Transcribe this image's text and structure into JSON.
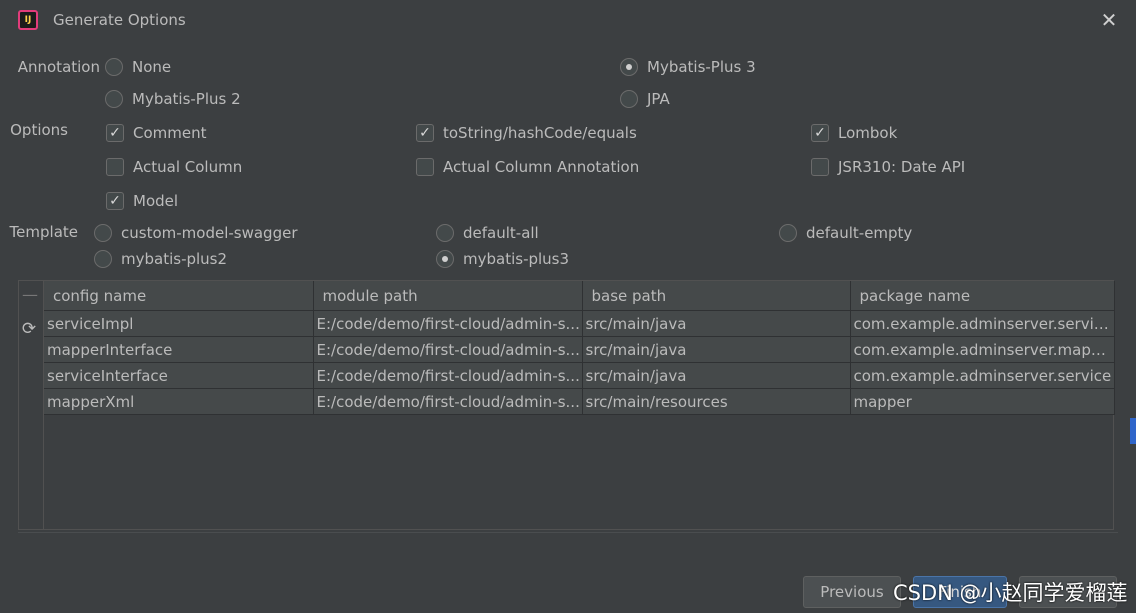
{
  "window": {
    "title": "Generate Options",
    "icon_name": "intellij-icon",
    "close_icon": "close-icon"
  },
  "annotation": {
    "label": "Annotation",
    "options": [
      {
        "label": "None",
        "checked": false
      },
      {
        "label": "Mybatis-Plus 3",
        "checked": true
      },
      {
        "label": "Mybatis-Plus 2",
        "checked": false
      },
      {
        "label": "JPA",
        "checked": false
      }
    ]
  },
  "options": {
    "label": "Options",
    "items": [
      {
        "label": "Comment",
        "checked": true
      },
      {
        "label": "toString/hashCode/equals",
        "checked": true
      },
      {
        "label": "Lombok",
        "checked": true
      },
      {
        "label": "Actual Column",
        "checked": false
      },
      {
        "label": "Actual Column Annotation",
        "checked": false
      },
      {
        "label": "JSR310: Date API",
        "checked": false
      },
      {
        "label": "Model",
        "checked": true
      }
    ]
  },
  "template": {
    "label": "Template",
    "options": [
      {
        "label": "custom-model-swagger",
        "checked": false
      },
      {
        "label": "default-all",
        "checked": false
      },
      {
        "label": "default-empty",
        "checked": false
      },
      {
        "label": "mybatis-plus2",
        "checked": false
      },
      {
        "label": "mybatis-plus3",
        "checked": true
      }
    ]
  },
  "table": {
    "columns": [
      "config name",
      "module path",
      "base path",
      "package name"
    ],
    "rows": [
      {
        "name": "serviceImpl",
        "module": "E:/code/demo/first-cloud/admin-s...",
        "base": "src/main/java",
        "pkg": "com.example.adminserver.service..."
      },
      {
        "name": "mapperInterface",
        "module": "E:/code/demo/first-cloud/admin-s...",
        "base": "src/main/java",
        "pkg": "com.example.adminserver.mapper"
      },
      {
        "name": "serviceInterface",
        "module": "E:/code/demo/first-cloud/admin-s...",
        "base": "src/main/java",
        "pkg": "com.example.adminserver.service"
      },
      {
        "name": "mapperXml",
        "module": "E:/code/demo/first-cloud/admin-s...",
        "base": "src/main/resources",
        "pkg": "mapper"
      }
    ],
    "remove_icon": "minus-icon",
    "refresh_icon": "refresh-icon"
  },
  "footer": {
    "previous_label": "Previous",
    "finish_label": "Finish",
    "watermark": "CSDN @小赵同学爱榴莲"
  }
}
